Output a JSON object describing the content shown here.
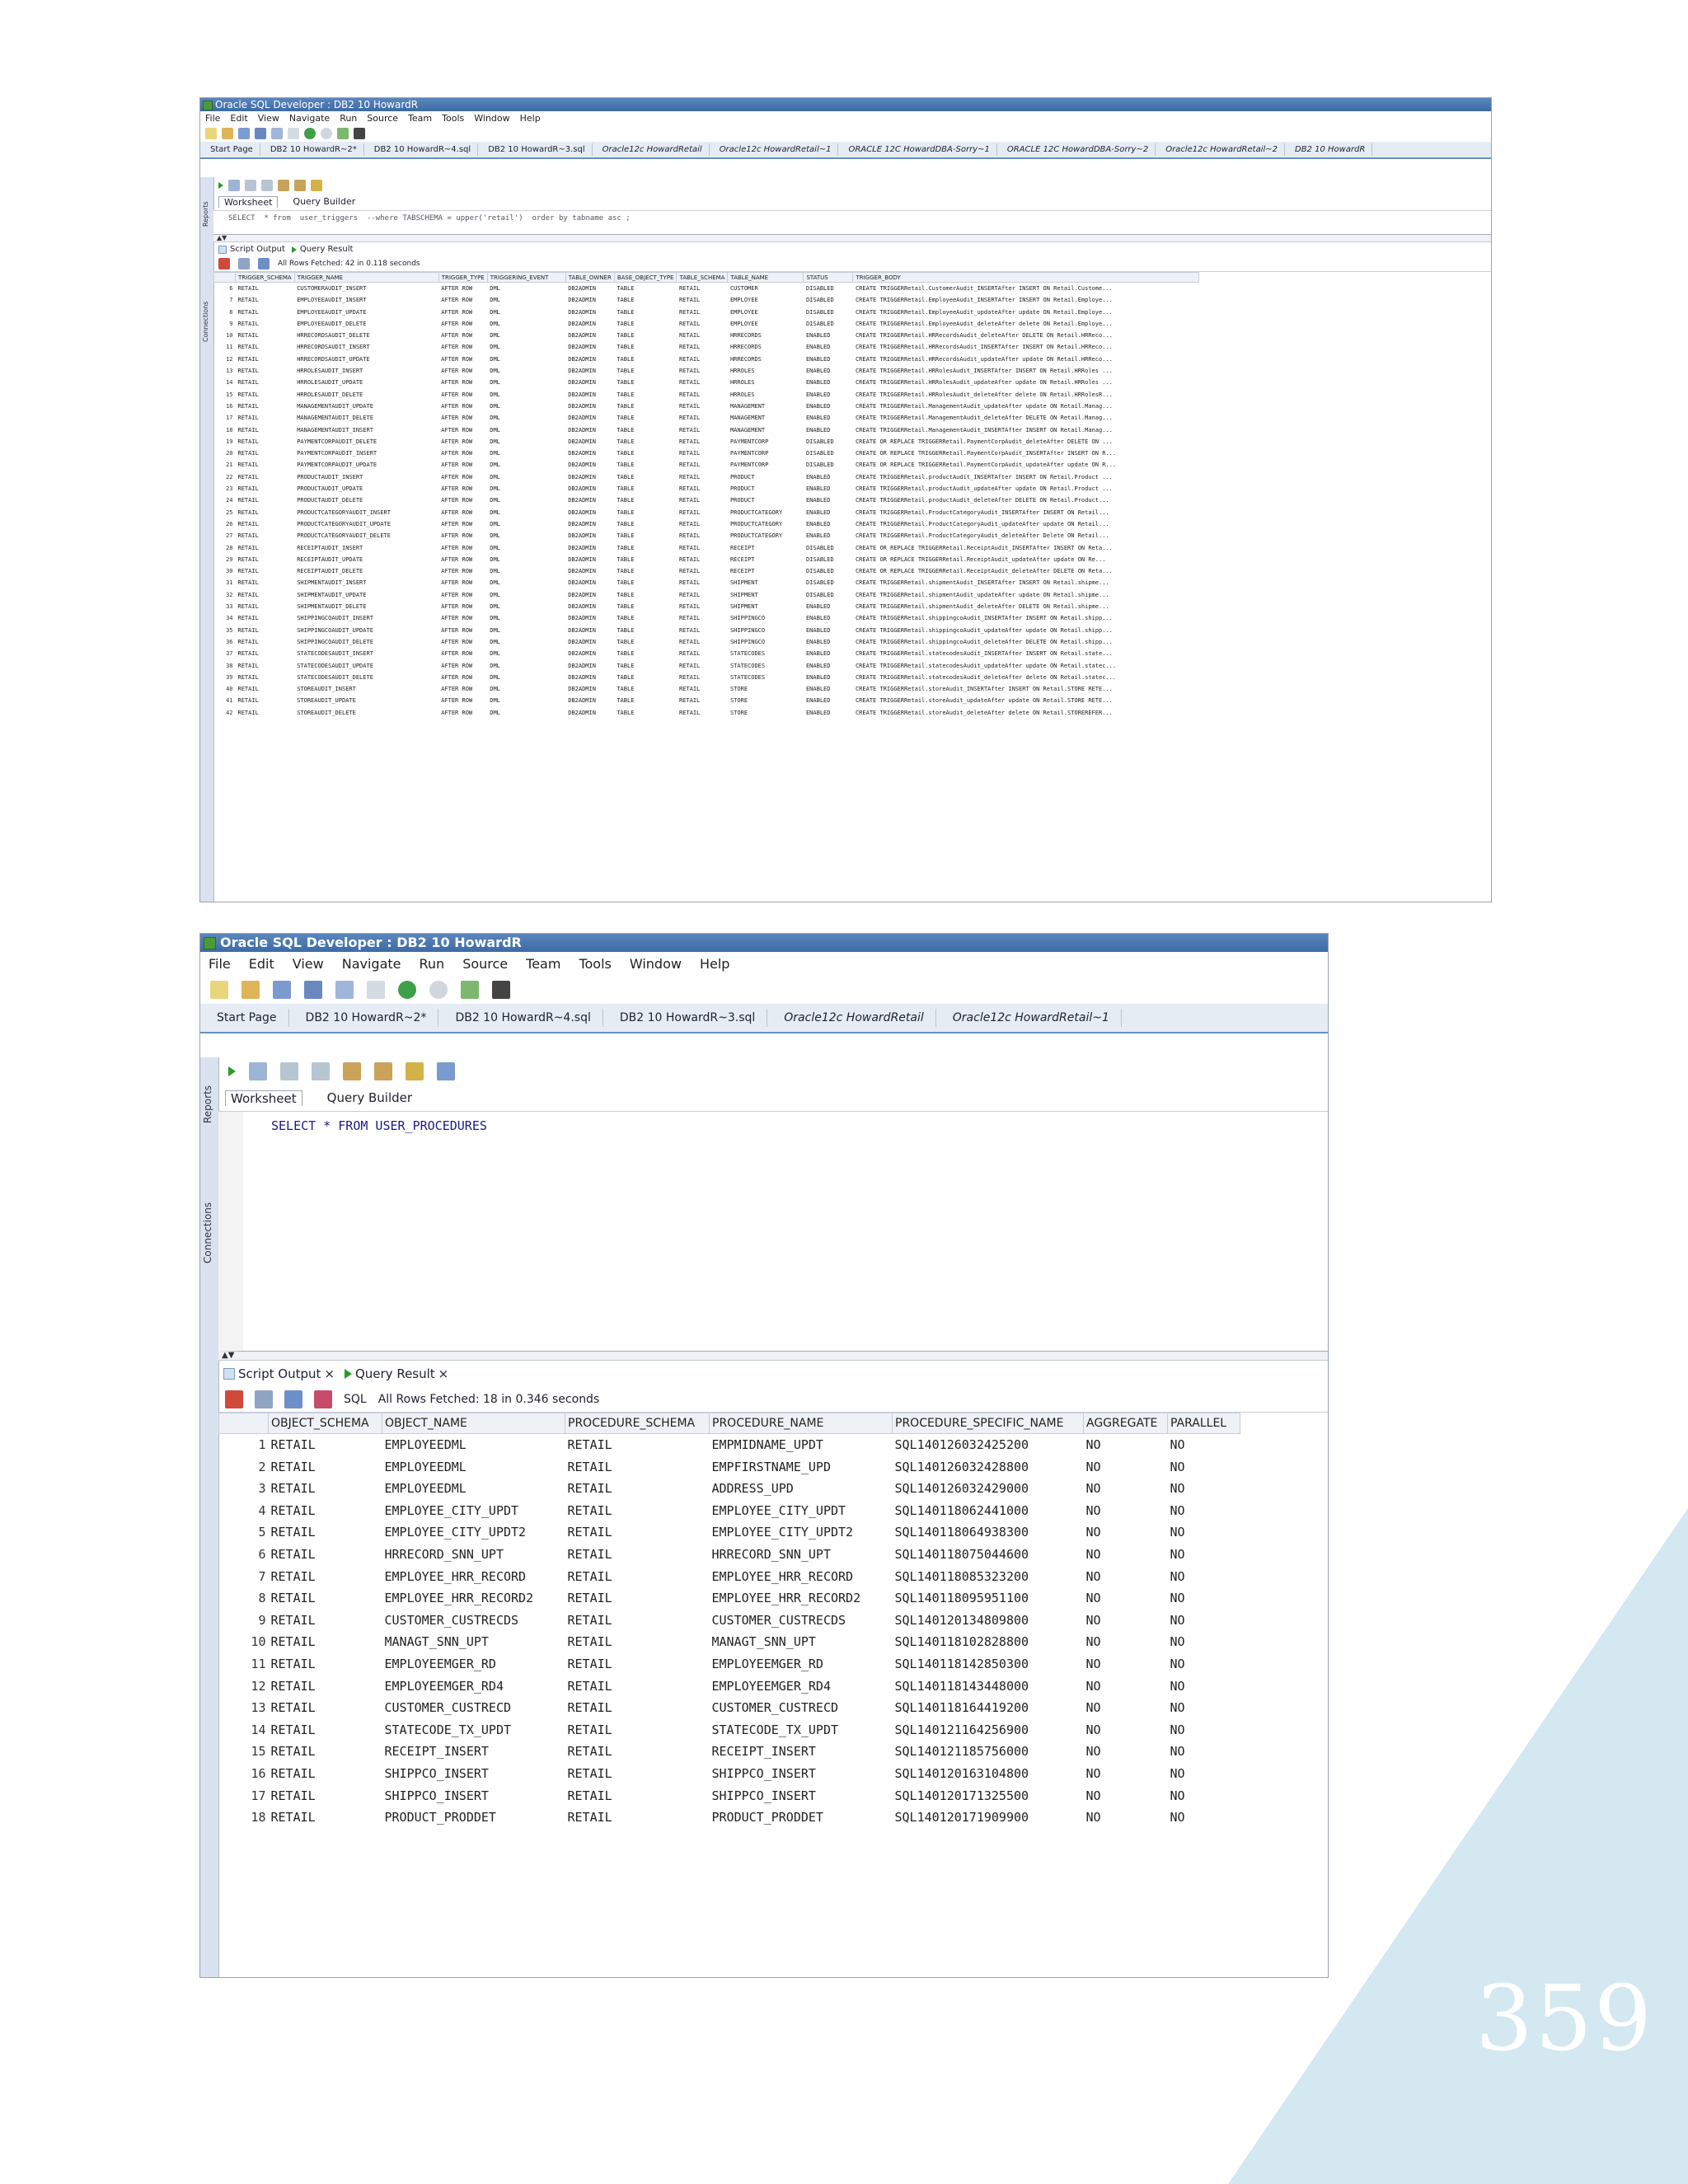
{
  "page_number": "359",
  "colors": {
    "corner_triangle": "#d3e8f0",
    "title_bar": "#4a76b0",
    "sql_keyword": "#1a1a8a"
  },
  "shot1": {
    "title": "Oracle SQL Developer : DB2 10 HowardR",
    "menu": [
      "File",
      "Edit",
      "View",
      "Navigate",
      "Run",
      "Source",
      "Team",
      "Tools",
      "Window",
      "Help"
    ],
    "doc_tabs": [
      "Start Page",
      "DB2 10 HowardR~2*",
      "DB2 10 HowardR~4.sql",
      "DB2 10 HowardR~3.sql",
      "Oracle12c HowardRetail",
      "Oracle12c HowardRetail~1",
      "ORACLE 12C HowardDBA-Sorry~1",
      "ORACLE 12C HowardDBA-Sorry~2",
      "Oracle12c HowardRetail~2",
      "DB2 10 HowardR"
    ],
    "rail_labels": [
      "Reports",
      "Connections"
    ],
    "sub_tabs": [
      "Worksheet",
      "Query Builder"
    ],
    "sql": "SELECT  * from  user_triggers  --where TABSCHEMA = upper('retail')  order by tabname asc ;",
    "result_tabs": [
      "Script Output",
      "Query Result"
    ],
    "status": "All Rows Fetched: 42 in 0.118 seconds",
    "columns": [
      "TRIGGER_SCHEMA",
      "TRIGGER_NAME",
      "TRIGGER_TYPE",
      "TRIGGERING_EVENT",
      "TABLE_OWNER",
      "BASE_OBJECT_TYPE",
      "TABLE_SCHEMA",
      "TABLE_NAME",
      "STATUS",
      "TRIGGER_BODY"
    ],
    "rows": [
      [
        "6",
        "RETAIL",
        "CUSTOMERAUDIT_INSERT",
        "AFTER ROW",
        "DML",
        "DB2ADMIN",
        "TABLE",
        "RETAIL",
        "CUSTOMER",
        "DISABLED",
        "CREATE TRIGGERRetail.CustomerAudit_INSERTAfter  INSERT  ON Retail.Custome..."
      ],
      [
        "7",
        "RETAIL",
        "EMPLOYEEAUDIT_INSERT",
        "AFTER ROW",
        "DML",
        "DB2ADMIN",
        "TABLE",
        "RETAIL",
        "EMPLOYEE",
        "DISABLED",
        "CREATE TRIGGERRetail.EmployeeAudit_INSERTAfter  INSERT  ON Retail.Employe..."
      ],
      [
        "8",
        "RETAIL",
        "EMPLOYEEAUDIT_UPDATE",
        "AFTER ROW",
        "DML",
        "DB2ADMIN",
        "TABLE",
        "RETAIL",
        "EMPLOYEE",
        "DISABLED",
        "CREATE TRIGGERRetail.EmployeeAudit_updateAfter  update  ON Retail.Employe..."
      ],
      [
        "9",
        "RETAIL",
        "EMPLOYEEAUDIT_DELETE",
        "AFTER ROW",
        "DML",
        "DB2ADMIN",
        "TABLE",
        "RETAIL",
        "EMPLOYEE",
        "DISABLED",
        "CREATE TRIGGERRetail.EmployeeAudit_deleteAfter  delete  ON Retail.Employe..."
      ],
      [
        "10",
        "RETAIL",
        "HRRECORDSAUDIT_DELETE",
        "AFTER ROW",
        "DML",
        "DB2ADMIN",
        "TABLE",
        "RETAIL",
        "HRRECORDS",
        "ENABLED",
        "CREATE TRIGGERRetail.HRRecordsAudit_deleteAfter  DELETE  ON Retail.HRReco..."
      ],
      [
        "11",
        "RETAIL",
        "HRRECORDSAUDIT_INSERT",
        "AFTER ROW",
        "DML",
        "DB2ADMIN",
        "TABLE",
        "RETAIL",
        "HRRECORDS",
        "ENABLED",
        "CREATE TRIGGERRetail.HRRecordsAudit_INSERTAfter  INSERT  ON Retail.HRReco..."
      ],
      [
        "12",
        "RETAIL",
        "HRRECORDSAUDIT_UPDATE",
        "AFTER ROW",
        "DML",
        "DB2ADMIN",
        "TABLE",
        "RETAIL",
        "HRRECORDS",
        "ENABLED",
        "CREATE TRIGGERRetail.HRRecordsAudit_updateAfter  update  ON Retail.HRReco..."
      ],
      [
        "13",
        "RETAIL",
        "HRROLESAUDIT_INSERT",
        "AFTER ROW",
        "DML",
        "DB2ADMIN",
        "TABLE",
        "RETAIL",
        "HRROLES",
        "ENABLED",
        "CREATE TRIGGERRetail.HRRolesAudit_INSERTAfter  INSERT  ON Retail.HRRoles ..."
      ],
      [
        "14",
        "RETAIL",
        "HRROLESAUDIT_UPDATE",
        "AFTER ROW",
        "DML",
        "DB2ADMIN",
        "TABLE",
        "RETAIL",
        "HRROLES",
        "ENABLED",
        "CREATE TRIGGERRetail.HRRolesAudit_updateAfter  update  ON Retail.HRRoles ..."
      ],
      [
        "15",
        "RETAIL",
        "HRROLESAUDIT_DELETE",
        "AFTER ROW",
        "DML",
        "DB2ADMIN",
        "TABLE",
        "RETAIL",
        "HRROLES",
        "ENABLED",
        "CREATE TRIGGERRetail.HRRolesAudit_deleteAfter  delete  ON Retail.HRRolesR..."
      ],
      [
        "16",
        "RETAIL",
        "MANAGEMENTAUDIT_UPDATE",
        "AFTER ROW",
        "DML",
        "DB2ADMIN",
        "TABLE",
        "RETAIL",
        "MANAGEMENT",
        "ENABLED",
        "CREATE TRIGGERRetail.ManagementAudit_updateAfter  update  ON Retail.Manag..."
      ],
      [
        "17",
        "RETAIL",
        "MANAGEMENTAUDIT_DELETE",
        "AFTER ROW",
        "DML",
        "DB2ADMIN",
        "TABLE",
        "RETAIL",
        "MANAGEMENT",
        "ENABLED",
        "CREATE TRIGGERRetail.ManagementAudit_deleteAfter  DELETE  ON Retail.Manag..."
      ],
      [
        "18",
        "RETAIL",
        "MANAGEMENTAUDIT_INSERT",
        "AFTER ROW",
        "DML",
        "DB2ADMIN",
        "TABLE",
        "RETAIL",
        "MANAGEMENT",
        "ENABLED",
        "CREATE TRIGGERRetail.ManagementAudit_INSERTAfter  INSERT  ON Retail.Manag..."
      ],
      [
        "19",
        "RETAIL",
        "PAYMENTCORPAUDIT_DELETE",
        "AFTER ROW",
        "DML",
        "DB2ADMIN",
        "TABLE",
        "RETAIL",
        "PAYMENTCORP",
        "DISABLED",
        "CREATE  OR REPLACE TRIGGERRetail.PaymentCorpAudit_deleteAfter  DELETE  ON ..."
      ],
      [
        "20",
        "RETAIL",
        "PAYMENTCORPAUDIT_INSERT",
        "AFTER ROW",
        "DML",
        "DB2ADMIN",
        "TABLE",
        "RETAIL",
        "PAYMENTCORP",
        "DISABLED",
        "CREATE OR REPLACE TRIGGERRetail.PaymentCorpAudit_INSERTAfter  INSERT  ON R..."
      ],
      [
        "21",
        "RETAIL",
        "PAYMENTCORPAUDIT_UPDATE",
        "AFTER ROW",
        "DML",
        "DB2ADMIN",
        "TABLE",
        "RETAIL",
        "PAYMENTCORP",
        "DISABLED",
        "CREATE OR REPLACE TRIGGERRetail.PaymentCorpAudit_updateAfter  update  ON R..."
      ],
      [
        "22",
        "RETAIL",
        "PRODUCTAUDIT_INSERT",
        "AFTER ROW",
        "DML",
        "DB2ADMIN",
        "TABLE",
        "RETAIL",
        "PRODUCT",
        "ENABLED",
        "CREATE TRIGGERRetail.productAudit_INSERTAfter  INSERT  ON Retail.Product ..."
      ],
      [
        "23",
        "RETAIL",
        "PRODUCTAUDIT_UPDATE",
        "AFTER ROW",
        "DML",
        "DB2ADMIN",
        "TABLE",
        "RETAIL",
        "PRODUCT",
        "ENABLED",
        "CREATE TRIGGERRetail.productAudit_updateAfter  update  ON Retail.Product ..."
      ],
      [
        "24",
        "RETAIL",
        "PRODUCTAUDIT_DELETE",
        "AFTER ROW",
        "DML",
        "DB2ADMIN",
        "TABLE",
        "RETAIL",
        "PRODUCT",
        "ENABLED",
        "CREATE TRIGGERRetail.productAudit_deleteAfter  DELETE  ON Retail.Product..."
      ],
      [
        "25",
        "RETAIL",
        "PRODUCTCATEGORYAUDIT_INSERT",
        "AFTER ROW",
        "DML",
        "DB2ADMIN",
        "TABLE",
        "RETAIL",
        "PRODUCTCATEGORY",
        "ENABLED",
        "CREATE TRIGGERRetail.ProductCategoryAudit_INSERTAfter  INSERT  ON Retail..."
      ],
      [
        "26",
        "RETAIL",
        "PRODUCTCATEGORYAUDIT_UPDATE",
        "AFTER ROW",
        "DML",
        "DB2ADMIN",
        "TABLE",
        "RETAIL",
        "PRODUCTCATEGORY",
        "ENABLED",
        "CREATE TRIGGERRetail.ProductCategoryAudit_updateAfter  update  ON Retail..."
      ],
      [
        "27",
        "RETAIL",
        "PRODUCTCATEGORYAUDIT_DELETE",
        "AFTER ROW",
        "DML",
        "DB2ADMIN",
        "TABLE",
        "RETAIL",
        "PRODUCTCATEGORY",
        "ENABLED",
        "CREATE TRIGGERRetail.ProductCategoryAudit_deleteAfter  Delete  ON Retail..."
      ],
      [
        "28",
        "RETAIL",
        "RECEIPTAUDIT_INSERT",
        "AFTER ROW",
        "DML",
        "DB2ADMIN",
        "TABLE",
        "RETAIL",
        "RECEIPT",
        "DISABLED",
        "CREATE OR REPLACE TRIGGERRetail.ReceiptAudit_INSERTAfter  INSERT  ON Reta..."
      ],
      [
        "29",
        "RETAIL",
        "RECEIPTAUDIT_UPDATE",
        "AFTER ROW",
        "DML",
        "DB2ADMIN",
        "TABLE",
        "RETAIL",
        "RECEIPT",
        "DISABLED",
        "CREATE  OR  REPLACE TRIGGERRetail.ReceiptAudit_updateAfter  update  ON Re..."
      ],
      [
        "30",
        "RETAIL",
        "RECEIPTAUDIT_DELETE",
        "AFTER ROW",
        "DML",
        "DB2ADMIN",
        "TABLE",
        "RETAIL",
        "RECEIPT",
        "DISABLED",
        "CREATE OR REPLACE TRIGGERRetail.ReceiptAudit_deleteAfter  DELETE  ON Reta..."
      ],
      [
        "31",
        "RETAIL",
        "SHIPMENTAUDIT_INSERT",
        "AFTER ROW",
        "DML",
        "DB2ADMIN",
        "TABLE",
        "RETAIL",
        "SHIPMENT",
        "DISABLED",
        "CREATE TRIGGERRetail.shipmentAudit_INSERTAfter  INSERT  ON Retail.shipme..."
      ],
      [
        "32",
        "RETAIL",
        "SHIPMENTAUDIT_UPDATE",
        "AFTER ROW",
        "DML",
        "DB2ADMIN",
        "TABLE",
        "RETAIL",
        "SHIPMENT",
        "DISABLED",
        "CREATE TRIGGERRetail.shipmentAudit_updateAfter  update  ON Retail.shipme..."
      ],
      [
        "33",
        "RETAIL",
        "SHIPMENTAUDIT_DELETE",
        "AFTER ROW",
        "DML",
        "DB2ADMIN",
        "TABLE",
        "RETAIL",
        "SHIPMENT",
        "ENABLED",
        "CREATE TRIGGERRetail.shipmentAudit_deleteAfter  DELETE  ON Retail.shipme..."
      ],
      [
        "34",
        "RETAIL",
        "SHIPPINGCOAUDIT_INSERT",
        "AFTER ROW",
        "DML",
        "DB2ADMIN",
        "TABLE",
        "RETAIL",
        "SHIPPINGCO",
        "ENABLED",
        "CREATE TRIGGERRetail.shippingcoAudit_INSERTAfter  INSERT  ON Retail.shipp..."
      ],
      [
        "35",
        "RETAIL",
        "SHIPPINGCOAUDIT_UPDATE",
        "AFTER ROW",
        "DML",
        "DB2ADMIN",
        "TABLE",
        "RETAIL",
        "SHIPPINGCO",
        "ENABLED",
        "CREATE TRIGGERRetail.shippingcoAudit_updateAfter  update  ON Retail.shipp..."
      ],
      [
        "36",
        "RETAIL",
        "SHIPPINGCOAUDIT_DELETE",
        "AFTER ROW",
        "DML",
        "DB2ADMIN",
        "TABLE",
        "RETAIL",
        "SHIPPINGCO",
        "ENABLED",
        "CREATE TRIGGERRetail.shippingcoAudit_deleteAfter  DELETE  ON Retail.shipp..."
      ],
      [
        "37",
        "RETAIL",
        "STATECODESAUDIT_INSERT",
        "AFTER ROW",
        "DML",
        "DB2ADMIN",
        "TABLE",
        "RETAIL",
        "STATECODES",
        "ENABLED",
        "CREATE TRIGGERRetail.statecodesAudit_INSERTAfter  INSERT  ON Retail.state..."
      ],
      [
        "38",
        "RETAIL",
        "STATECODESAUDIT_UPDATE",
        "AFTER ROW",
        "DML",
        "DB2ADMIN",
        "TABLE",
        "RETAIL",
        "STATECODES",
        "ENABLED",
        "CREATE TRIGGERRetail.statecodesAudit_updateAfter  update  ON Retail.statec..."
      ],
      [
        "39",
        "RETAIL",
        "STATECODESAUDIT_DELETE",
        "AFTER ROW",
        "DML",
        "DB2ADMIN",
        "TABLE",
        "RETAIL",
        "STATECODES",
        "ENABLED",
        "CREATE TRIGGERRetail.statecodesAudit_deleteAfter  delete  ON Retail.statec..."
      ],
      [
        "40",
        "RETAIL",
        "STOREAUDIT_INSERT",
        "AFTER ROW",
        "DML",
        "DB2ADMIN",
        "TABLE",
        "RETAIL",
        "STORE",
        "ENABLED",
        "CREATE TRIGGERRetail.storeAudit_INSERTAfter  INSERT  ON Retail.STORE RETE..."
      ],
      [
        "41",
        "RETAIL",
        "STOREAUDIT_UPDATE",
        "AFTER ROW",
        "DML",
        "DB2ADMIN",
        "TABLE",
        "RETAIL",
        "STORE",
        "ENABLED",
        "CREATE TRIGGERRetail.storeAudit_updateAfter  update  ON Retail.STORE RETE..."
      ],
      [
        "42",
        "RETAIL",
        "STOREAUDIT_DELETE",
        "AFTER ROW",
        "DML",
        "DB2ADMIN",
        "TABLE",
        "RETAIL",
        "STORE",
        "ENABLED",
        "CREATE TRIGGERRetail.storeAudit_deleteAfter  delete  ON Retail.STOREREFER..."
      ]
    ]
  },
  "shot2": {
    "title": "Oracle SQL Developer : DB2 10 HowardR",
    "menu": [
      "File",
      "Edit",
      "View",
      "Navigate",
      "Run",
      "Source",
      "Team",
      "Tools",
      "Window",
      "Help"
    ],
    "doc_tabs": [
      "Start Page",
      "DB2 10 HowardR~2*",
      "DB2 10 HowardR~4.sql",
      "DB2 10 HowardR~3.sql",
      "Oracle12c HowardRetail",
      "Oracle12c HowardRetail~1"
    ],
    "rail_labels": [
      "Reports",
      "Connections"
    ],
    "sub_tabs": [
      "Worksheet",
      "Query Builder"
    ],
    "sql": "SELECT * FROM USER_PROCEDURES",
    "result_tabs": [
      "Script Output",
      "Query Result"
    ],
    "sql_label": "SQL",
    "status": "All Rows Fetched: 18 in 0.346 seconds",
    "columns": [
      "OBJECT_SCHEMA",
      "OBJECT_NAME",
      "PROCEDURE_SCHEMA",
      "PROCEDURE_NAME",
      "PROCEDURE_SPECIFIC_NAME",
      "AGGREGATE",
      "PARALLEL"
    ],
    "rows": [
      [
        "1",
        "RETAIL",
        "EMPLOYEEDML",
        "RETAIL",
        "EMPMIDNAME_UPDT",
        "SQL140126032425200",
        "NO",
        "NO"
      ],
      [
        "2",
        "RETAIL",
        "EMPLOYEEDML",
        "RETAIL",
        "EMPFIRSTNAME_UPD",
        "SQL140126032428800",
        "NO",
        "NO"
      ],
      [
        "3",
        "RETAIL",
        "EMPLOYEEDML",
        "RETAIL",
        "ADDRESS_UPD",
        "SQL140126032429000",
        "NO",
        "NO"
      ],
      [
        "4",
        "RETAIL",
        "EMPLOYEE_CITY_UPDT",
        "RETAIL",
        "EMPLOYEE_CITY_UPDT",
        "SQL140118062441000",
        "NO",
        "NO"
      ],
      [
        "5",
        "RETAIL",
        "EMPLOYEE_CITY_UPDT2",
        "RETAIL",
        "EMPLOYEE_CITY_UPDT2",
        "SQL140118064938300",
        "NO",
        "NO"
      ],
      [
        "6",
        "RETAIL",
        "HRRECORD_SNN_UPT",
        "RETAIL",
        "HRRECORD_SNN_UPT",
        "SQL140118075044600",
        "NO",
        "NO"
      ],
      [
        "7",
        "RETAIL",
        "EMPLOYEE_HRR_RECORD",
        "RETAIL",
        "EMPLOYEE_HRR_RECORD",
        "SQL140118085323200",
        "NO",
        "NO"
      ],
      [
        "8",
        "RETAIL",
        "EMPLOYEE_HRR_RECORD2",
        "RETAIL",
        "EMPLOYEE_HRR_RECORD2",
        "SQL140118095951100",
        "NO",
        "NO"
      ],
      [
        "9",
        "RETAIL",
        "CUSTOMER_CUSTRECDS",
        "RETAIL",
        "CUSTOMER_CUSTRECDS",
        "SQL140120134809800",
        "NO",
        "NO"
      ],
      [
        "10",
        "RETAIL",
        "MANAGT_SNN_UPT",
        "RETAIL",
        "MANAGT_SNN_UPT",
        "SQL140118102828800",
        "NO",
        "NO"
      ],
      [
        "11",
        "RETAIL",
        "EMPLOYEEMGER_RD",
        "RETAIL",
        "EMPLOYEEMGER_RD",
        "SQL140118142850300",
        "NO",
        "NO"
      ],
      [
        "12",
        "RETAIL",
        "EMPLOYEEMGER_RD4",
        "RETAIL",
        "EMPLOYEEMGER_RD4",
        "SQL140118143448000",
        "NO",
        "NO"
      ],
      [
        "13",
        "RETAIL",
        "CUSTOMER_CUSTRECD",
        "RETAIL",
        "CUSTOMER_CUSTRECD",
        "SQL140118164419200",
        "NO",
        "NO"
      ],
      [
        "14",
        "RETAIL",
        "STATECODE_TX_UPDT",
        "RETAIL",
        "STATECODE_TX_UPDT",
        "SQL140121164256900",
        "NO",
        "NO"
      ],
      [
        "15",
        "RETAIL",
        "RECEIPT_INSERT",
        "RETAIL",
        "RECEIPT_INSERT",
        "SQL140121185756000",
        "NO",
        "NO"
      ],
      [
        "16",
        "RETAIL",
        "SHIPPCO_INSERT",
        "RETAIL",
        "SHIPPCO_INSERT",
        "SQL140120163104800",
        "NO",
        "NO"
      ],
      [
        "17",
        "RETAIL",
        "SHIPPCO_INSERT",
        "RETAIL",
        "SHIPPCO_INSERT",
        "SQL140120171325500",
        "NO",
        "NO"
      ],
      [
        "18",
        "RETAIL",
        "PRODUCT_PRODDET",
        "RETAIL",
        "PRODUCT_PRODDET",
        "SQL140120171909900",
        "NO",
        "NO"
      ]
    ]
  }
}
